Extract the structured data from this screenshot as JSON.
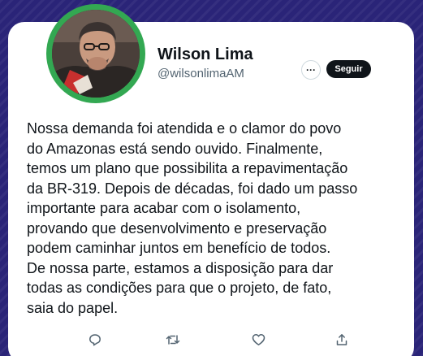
{
  "profile": {
    "display_name": "Wilson Lima",
    "handle": "@wilsonlimaAM",
    "avatar_ring_color": "#33a852"
  },
  "header_actions": {
    "more_label": "···",
    "follow_label": "Seguir"
  },
  "tweet": {
    "lines": [
      "Nossa demanda foi atendida e o clamor do povo",
      "do Amazonas está sendo ouvido. Finalmente,",
      "temos um plano que possibilita a repavimentação",
      "da BR-319. Depois de décadas, foi dado um passo",
      "importante para acabar com o isolamento,",
      "provando que desenvolvimento e preservação",
      "podem caminhar juntos em benefício de todos.",
      "De nossa parte, estamos a disposição para dar",
      "todas as condições para que o projeto, de fato,",
      "saia do papel."
    ]
  },
  "actions": [
    {
      "icon": "reply-icon"
    },
    {
      "icon": "retweet-icon"
    },
    {
      "icon": "like-icon"
    },
    {
      "icon": "share-icon"
    }
  ],
  "colors": {
    "background": "#2a2478",
    "card": "#ffffff",
    "text": "#0f1419",
    "secondary_text": "#536471",
    "follow_button": "#0f1419"
  }
}
